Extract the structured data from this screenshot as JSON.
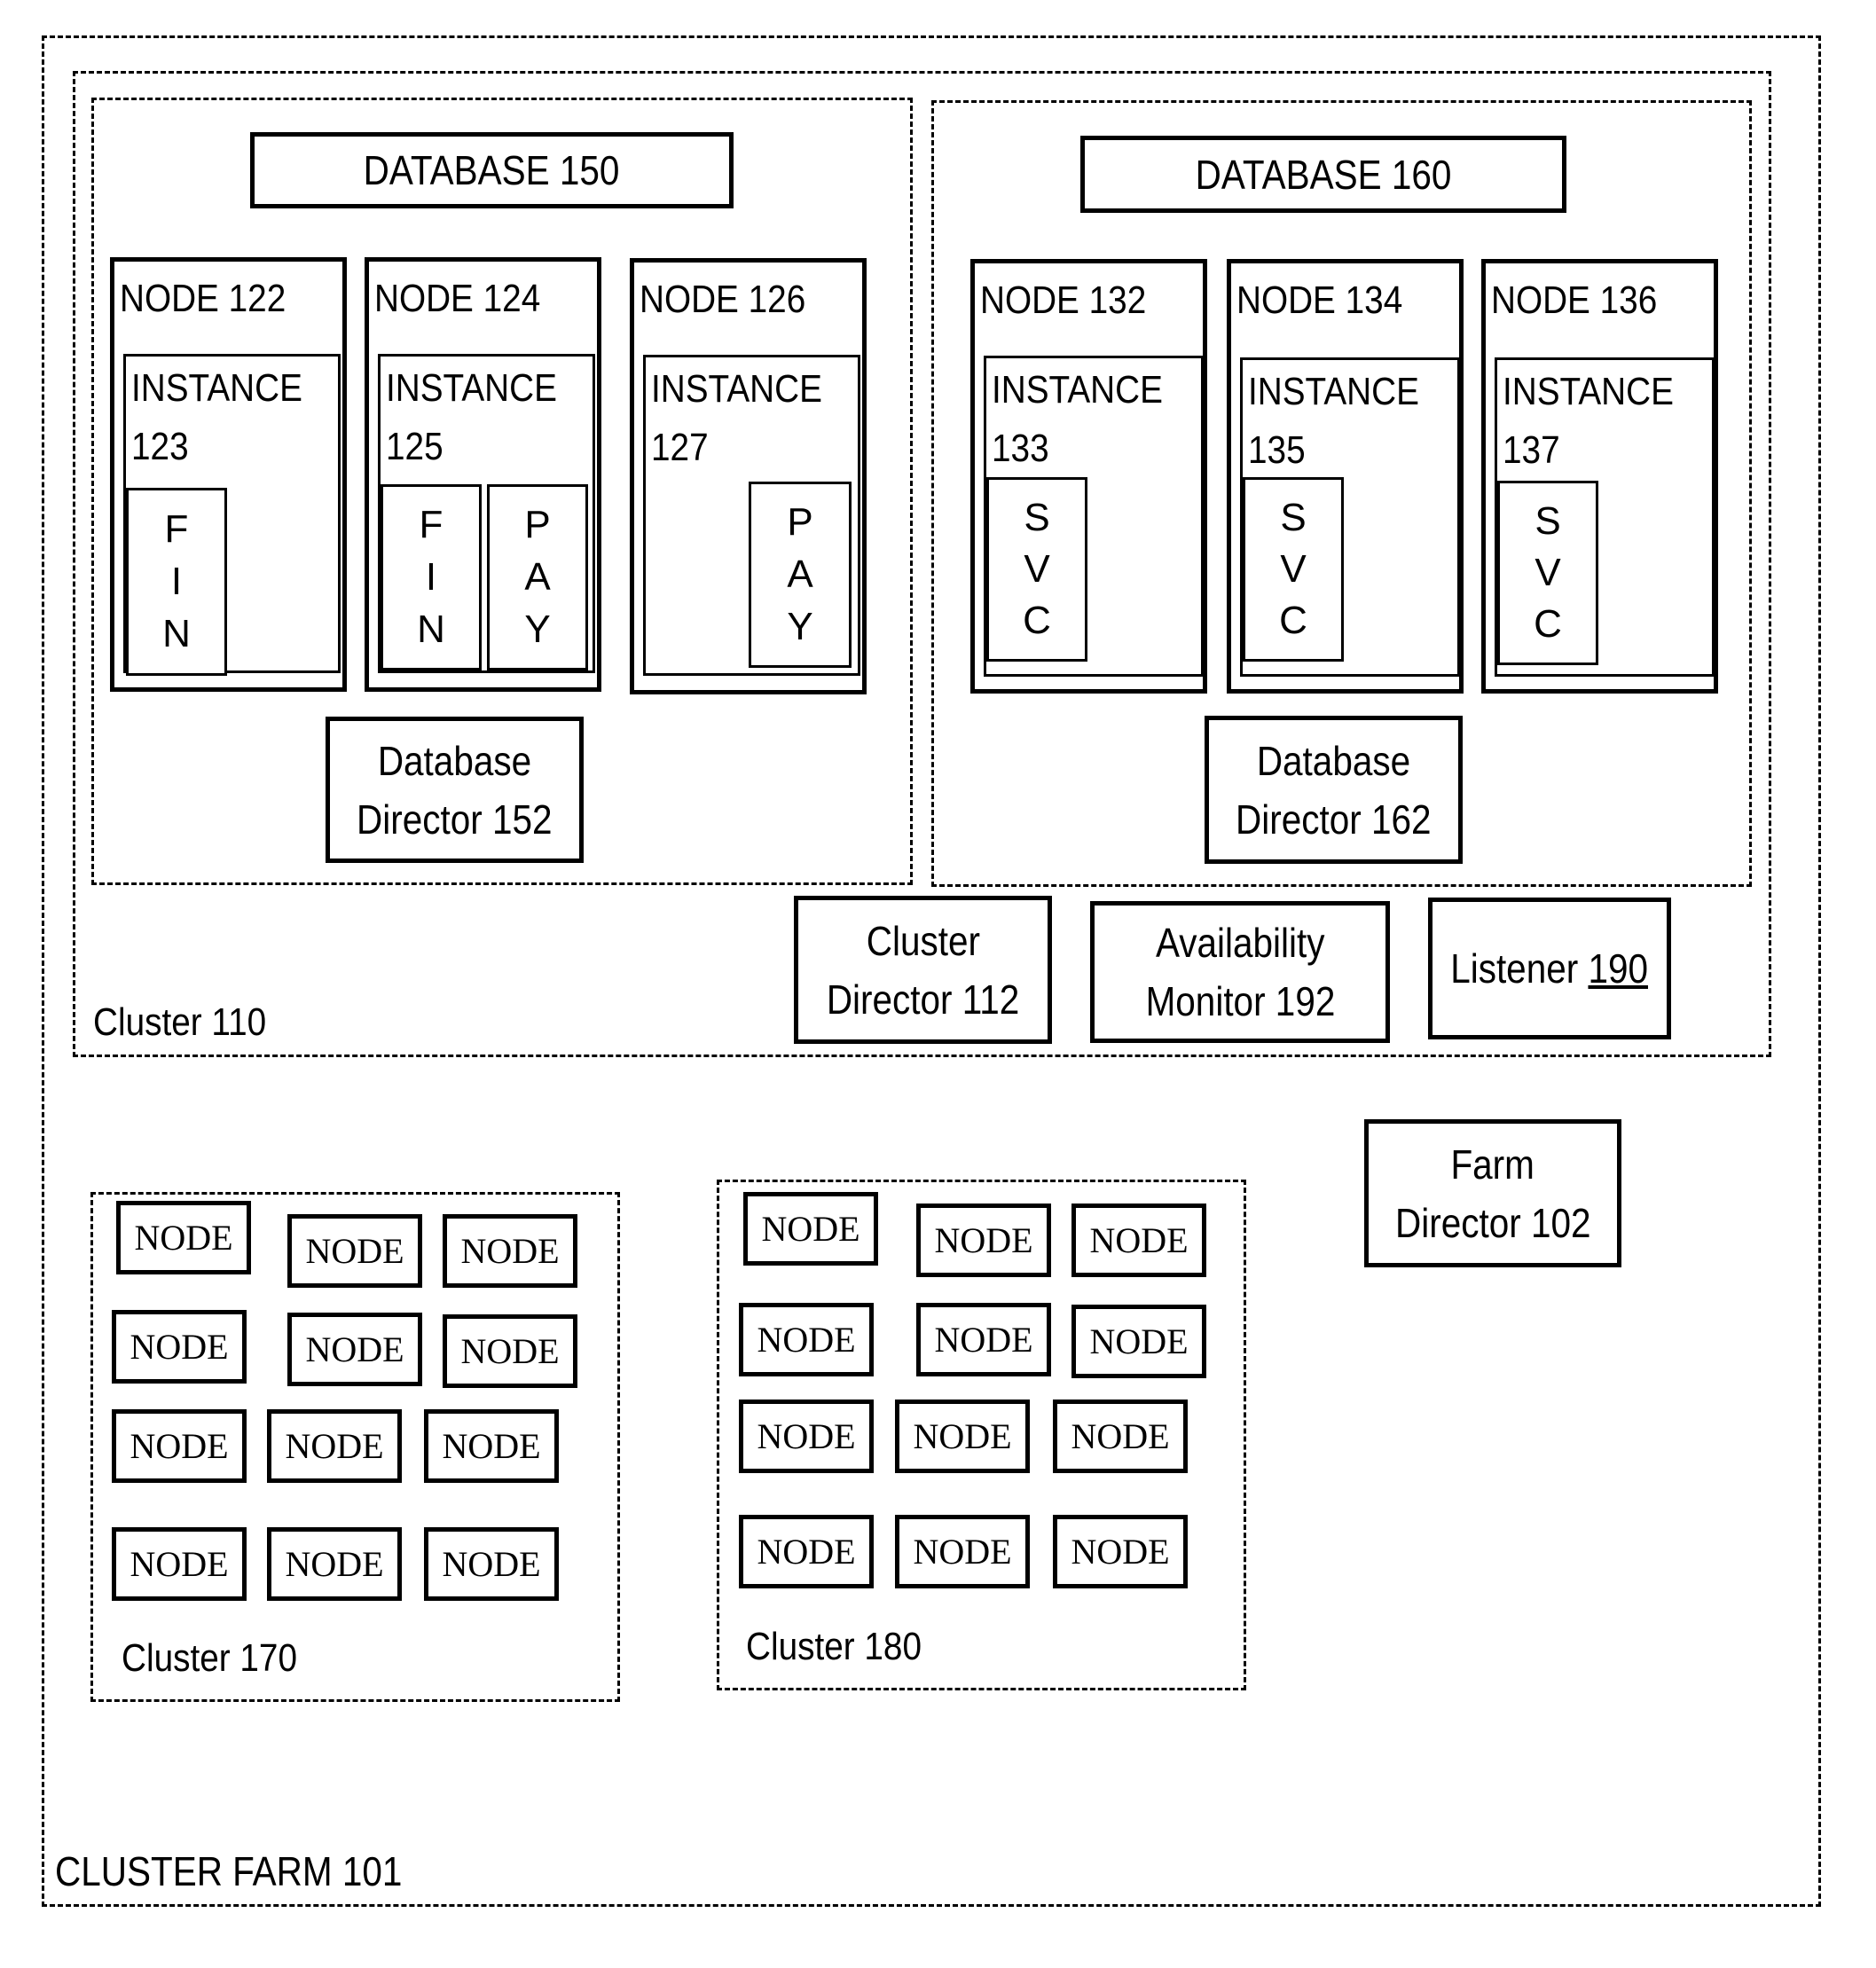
{
  "farm": {
    "label": "CLUSTER FARM 101",
    "director": {
      "line1": "Farm",
      "line2": "Director 102"
    }
  },
  "cluster110": {
    "label": "Cluster 110",
    "director": {
      "line1": "Cluster",
      "line2": "Director 112"
    },
    "availability_monitor": {
      "line1": "Availability",
      "line2": "Monitor 192"
    },
    "listener": {
      "text": "Listener ",
      "number": "190"
    },
    "db150": {
      "title": "DATABASE  150",
      "director": {
        "line1": "Database",
        "line2": "Director 152"
      },
      "nodes": [
        {
          "label": "NODE 122",
          "instance": {
            "line1": "INSTANCE",
            "line2": "123"
          },
          "services": [
            {
              "letters": [
                "F",
                "I",
                "N"
              ]
            }
          ]
        },
        {
          "label": "NODE 124",
          "instance": {
            "line1": "INSTANCE",
            "line2": "125"
          },
          "services": [
            {
              "letters": [
                "F",
                "I",
                "N"
              ]
            },
            {
              "letters": [
                "P",
                "A",
                "Y"
              ]
            }
          ]
        },
        {
          "label": "NODE 126",
          "instance": {
            "line1": "INSTANCE",
            "line2": "127"
          },
          "services": [
            {
              "letters": [
                "P",
                "A",
                "Y"
              ]
            }
          ]
        }
      ]
    },
    "db160": {
      "title": "DATABASE  160",
      "director": {
        "line1": "Database",
        "line2": "Director 162"
      },
      "nodes": [
        {
          "label": "NODE 132",
          "instance": {
            "line1": "INSTANCE",
            "line2": "133"
          },
          "services": [
            {
              "letters": [
                "S",
                "V",
                "C"
              ]
            }
          ]
        },
        {
          "label": "NODE 134",
          "instance": {
            "line1": "INSTANCE",
            "line2": "135"
          },
          "services": [
            {
              "letters": [
                "S",
                "V",
                "C"
              ]
            }
          ]
        },
        {
          "label": "NODE 136",
          "instance": {
            "line1": "INSTANCE",
            "line2": "137"
          },
          "services": [
            {
              "letters": [
                "S",
                "V",
                "C"
              ]
            }
          ]
        }
      ]
    }
  },
  "cluster170": {
    "label": "Cluster 170",
    "node_label": "NODE",
    "node_count": 12
  },
  "cluster180": {
    "label": "Cluster 180",
    "node_label": "NODE",
    "node_count": 12
  }
}
